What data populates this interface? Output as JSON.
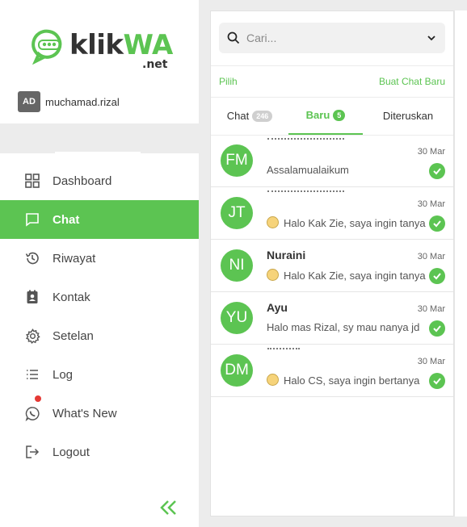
{
  "brand": {
    "name_dark": "klik",
    "name_accent": "WA",
    "suffix": ".net",
    "accent_color": "#5cc452"
  },
  "user": {
    "initials": "AD",
    "username": "muchamad.rizal"
  },
  "nav": [
    {
      "label": "Dashboard",
      "icon": "dashboard-icon",
      "active": false
    },
    {
      "label": "Chat",
      "icon": "chat-icon",
      "active": true
    },
    {
      "label": "Riwayat",
      "icon": "history-icon",
      "active": false
    },
    {
      "label": "Kontak",
      "icon": "contact-icon",
      "active": false
    },
    {
      "label": "Setelan",
      "icon": "gear-icon",
      "active": false
    },
    {
      "label": "Log",
      "icon": "log-icon",
      "active": false
    },
    {
      "label": "What's New",
      "icon": "whatsapp-icon",
      "active": false,
      "notification": true
    },
    {
      "label": "Logout",
      "icon": "logout-icon",
      "active": false
    }
  ],
  "search": {
    "placeholder": "Cari..."
  },
  "actions": {
    "select": "Pilih",
    "new_chat": "Buat Chat Baru"
  },
  "tabs": [
    {
      "label": "Chat",
      "badge": "246",
      "active": false
    },
    {
      "label": "Baru",
      "badge": "5",
      "active": true
    },
    {
      "label": "Diteruskan",
      "badge": "",
      "active": false
    }
  ],
  "chats": [
    {
      "initials": "FM",
      "name": "",
      "date": "30 Mar",
      "message": "Assalamualaikum",
      "emoji": false
    },
    {
      "initials": "JT",
      "name": "",
      "date": "30 Mar",
      "message": "Halo Kak Zie, saya ingin tanya",
      "emoji": true
    },
    {
      "initials": "NI",
      "name": "Nuraini",
      "date": "30 Mar",
      "message": "Halo Kak Zie, saya ingin tanya",
      "emoji": true
    },
    {
      "initials": "YU",
      "name": "Ayu",
      "date": "30 Mar",
      "message": "Halo mas Rizal, sy mau nanya jd",
      "emoji": false
    },
    {
      "initials": "DM",
      "name": "",
      "date": "30 Mar",
      "message": "Halo CS, saya ingin bertanya",
      "emoji": true
    }
  ]
}
